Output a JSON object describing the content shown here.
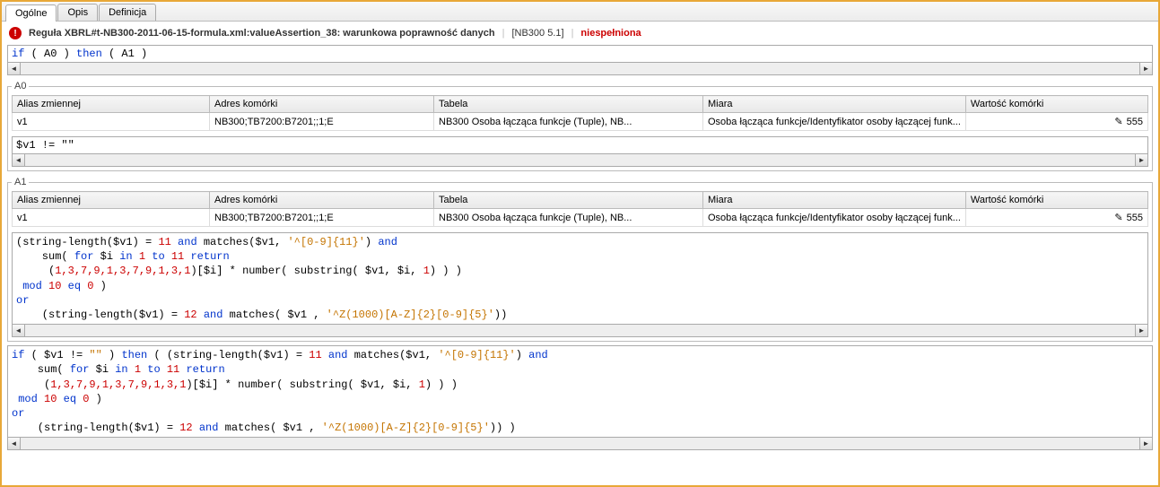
{
  "tabs": {
    "t0": "Ogólne",
    "t1": "Opis",
    "t2": "Definicja"
  },
  "header": {
    "rule": "Reguła XBRL#t-NB300-2011-06-15-formula.xml:valueAssertion_38: warunkowa poprawność danych",
    "code": "[NB300 5.1]",
    "status": "niespełniona"
  },
  "topCodeParts": {
    "p1": "if",
    "p2": " ( A0 ) ",
    "p3": "then",
    "p4": " ( A1 )"
  },
  "cols": {
    "alias": "Alias zmiennej",
    "addr": "Adres komórki",
    "tabela": "Tabela",
    "miara": "Miara",
    "wartosc": "Wartość komórki"
  },
  "a0": {
    "legend": "A0",
    "row": {
      "alias": "v1",
      "addr": "NB300;TB7200:B7201;;1;E",
      "tabela": "NB300 Osoba łącząca funkcje (Tuple), NB...",
      "miara": "Osoba łącząca funkcje/Identyfikator osoby łączącej funk...",
      "wartosc": "555"
    },
    "expr": "$v1 != \"\""
  },
  "a1": {
    "legend": "A1",
    "row": {
      "alias": "v1",
      "addr": "NB300;TB7200:B7201;;1;E",
      "tabela": "NB300 Osoba łącząca funkcje (Tuple), NB...",
      "miara": "Osoba łącząca funkcje/Identyfikator osoby łączącej funk...",
      "wartosc": "555"
    },
    "code": {
      "l1a": "(string-length($v1) = ",
      "l1b": "11",
      "l1c": " and",
      "l1d": " matches($v1, ",
      "l1e": "'^[0-9]{11}'",
      "l1f": ") ",
      "l1g": "and",
      "l2a": "    sum( ",
      "l2b": "for",
      "l2c": " $i ",
      "l2d": "in",
      "l2e": " 1",
      "l2f": " to",
      "l2g": " 11",
      "l2h": " return",
      "l3a": "     (",
      "l3b": "1,3,7,9,1,3,7,9,1,3,1",
      "l3c": ")[$i] * number( substring( $v1, $i, ",
      "l3d": "1",
      "l3e": ") ) )",
      "l4a": " mod",
      "l4b": " 10",
      "l4c": " eq",
      "l4d": " 0",
      "l4e": " )",
      "l5a": "or",
      "l6a": "    (string-length($v1) = ",
      "l6b": "12",
      "l6c": " and",
      "l6d": " matches( $v1 , ",
      "l6e": "'^Z(1000)[A-Z]{2}[0-9]{5}'",
      "l6f": "))"
    }
  },
  "bottomCode": {
    "l1a": "if",
    "l1b": " ( $v1 != ",
    "l1c": "\"\"",
    "l1d": " ) ",
    "l1e": "then",
    "l1f": " ( (string-length($v1) = ",
    "l1g": "11",
    "l1h": " and",
    "l1i": " matches($v1, ",
    "l1j": "'^[0-9]{11}'",
    "l1k": ") ",
    "l1l": "and",
    "l2a": "    sum( ",
    "l2b": "for",
    "l2c": " $i ",
    "l2d": "in",
    "l2e": " 1",
    "l2f": " to",
    "l2g": " 11",
    "l2h": " return",
    "l3a": "     (",
    "l3b": "1,3,7,9,1,3,7,9,1,3,1",
    "l3c": ")[$i] * number( substring( $v1, $i, ",
    "l3d": "1",
    "l3e": ") ) )",
    "l4a": " mod",
    "l4b": " 10",
    "l4c": " eq",
    "l4d": " 0",
    "l4e": " )",
    "l5a": "or",
    "l6a": "    (string-length($v1) = ",
    "l6b": "12",
    "l6c": " and",
    "l6d": " matches( $v1 , ",
    "l6e": "'^Z(1000)[A-Z]{2}[0-9]{5}'",
    "l6f": ")) )"
  }
}
